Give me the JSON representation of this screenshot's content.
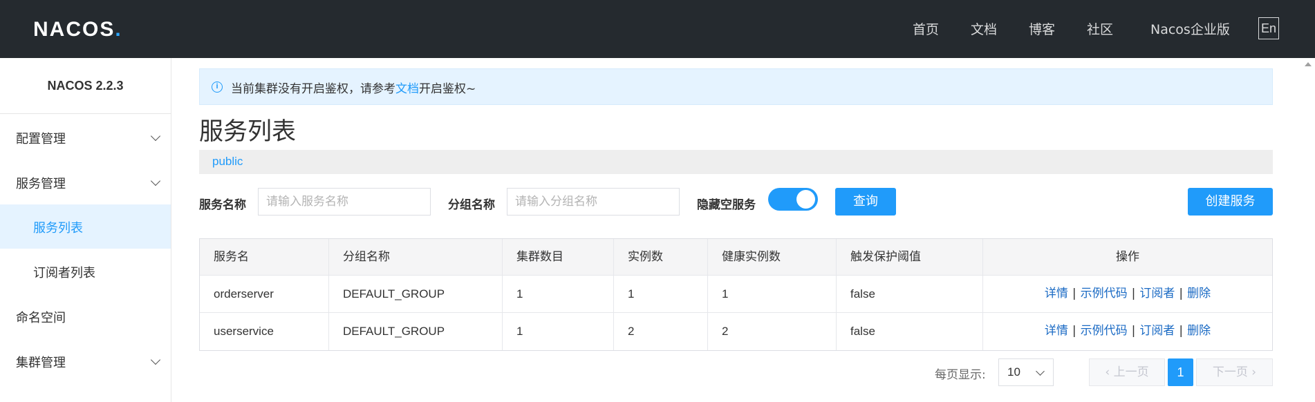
{
  "header": {
    "logo_text": "NACOS",
    "logo_dot": ".",
    "nav": [
      "首页",
      "文档",
      "博客",
      "社区",
      "Nacos企业版"
    ],
    "lang_button": "En"
  },
  "sidebar": {
    "version": "NACOS 2.2.3",
    "items": [
      {
        "label": "配置管理",
        "expandable": true
      },
      {
        "label": "服务管理",
        "expandable": true
      },
      {
        "label": "服务列表",
        "active": true
      },
      {
        "label": "订阅者列表"
      },
      {
        "label": "命名空间"
      },
      {
        "label": "集群管理",
        "expandable": true
      }
    ]
  },
  "notice": {
    "text_before": "当前集群没有开启鉴权，请参考",
    "link": "文档",
    "text_after": "开启鉴权~"
  },
  "page_title": "服务列表",
  "namespace": "public",
  "filters": {
    "service_name_label": "服务名称",
    "service_name_placeholder": "请输入服务名称",
    "group_name_label": "分组名称",
    "group_name_placeholder": "请输入分组名称",
    "hide_empty_label": "隐藏空服务",
    "hide_empty_on": true,
    "query_button": "查询",
    "create_button": "创建服务"
  },
  "table": {
    "columns": [
      "服务名",
      "分组名称",
      "集群数目",
      "实例数",
      "健康实例数",
      "触发保护阈值",
      "操作"
    ],
    "rows": [
      {
        "name": "orderserver",
        "group": "DEFAULT_GROUP",
        "clusters": "1",
        "instances": "1",
        "healthy": "1",
        "threshold": "false"
      },
      {
        "name": "userservice",
        "group": "DEFAULT_GROUP",
        "clusters": "1",
        "instances": "2",
        "healthy": "2",
        "threshold": "false"
      }
    ],
    "ops": {
      "detail": "详情",
      "sample": "示例代码",
      "subscribers": "订阅者",
      "delete": "删除",
      "separator": "|"
    }
  },
  "pagination": {
    "page_size_label": "每页显示:",
    "page_size": "10",
    "prev": "上一页",
    "current": "1",
    "next": "下一页"
  },
  "colors": {
    "topbar": "#252a2f",
    "primary": "#209bfa",
    "link": "#1a6ac4"
  }
}
